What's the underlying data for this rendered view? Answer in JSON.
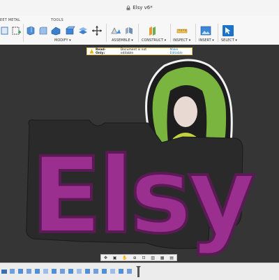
{
  "window": {
    "title": "Elsy v6*"
  },
  "toolbar": {
    "tab_sheet_metal": "EET METAL",
    "tab_tools": "TOOLS",
    "groups": {
      "modify": "MODIFY ▾",
      "assemble": "ASSEMBLE ▾",
      "construct": "CONSTRUCT ▾",
      "inspect": "INSPECT ▾",
      "insert": "INSERT ▾",
      "select": "SELECT ▾"
    }
  },
  "banner": {
    "read_only_label": "Read-Only:",
    "message": "Document is not editable",
    "action": "Make Editable"
  },
  "model": {
    "text": "Elsy",
    "colors": {
      "letter": "#9b2f8f",
      "letter_edge": "#6e1f67",
      "base": "#2a2a2a",
      "halo": "#7ab540",
      "face": "#e9d9d3",
      "robe": "#c2d33f"
    }
  },
  "navbar": {
    "icons": [
      "orbit-icon",
      "look-icon",
      "pan-icon",
      "zoom-icon",
      "fit-icon",
      "display-icon",
      "grid-icon",
      "viewports-icon"
    ]
  },
  "colors": {
    "accent": "#1a73c9",
    "viewport_bg": "#353535"
  }
}
